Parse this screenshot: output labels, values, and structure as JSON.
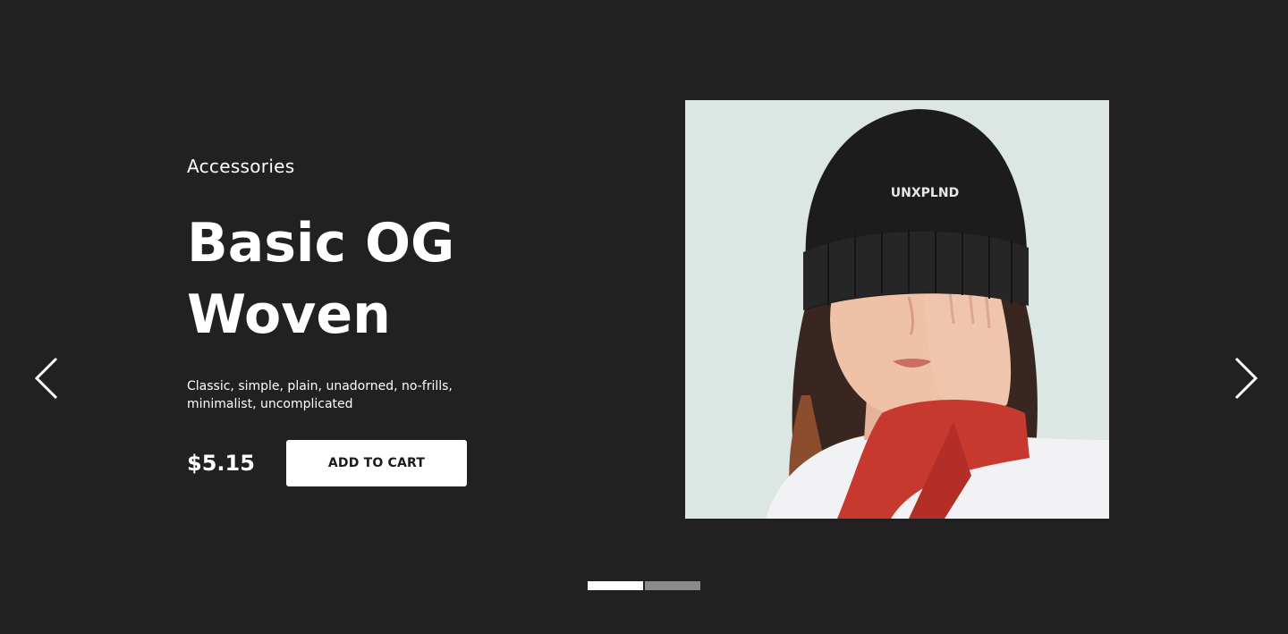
{
  "slide": {
    "category": "Accessories",
    "title": "Basic OG Woven",
    "description": "Classic, simple, plain, unadorned, no-frills, minimalist, uncomplicated",
    "price": "$5.15",
    "add_to_cart_label": "ADD TO CART"
  },
  "image": {
    "beanie_text": "UNXPLND"
  },
  "navigation": {
    "prev_icon": "chevron-left-icon",
    "next_icon": "chevron-right-icon"
  },
  "pagination": {
    "total": 2,
    "active_index": 0,
    "active_color": "#ffffff",
    "inactive_color": "#8a8a8a"
  },
  "colors": {
    "background": "#212121",
    "text": "#ffffff",
    "button_bg": "#ffffff",
    "button_text": "#1a1a1a"
  }
}
